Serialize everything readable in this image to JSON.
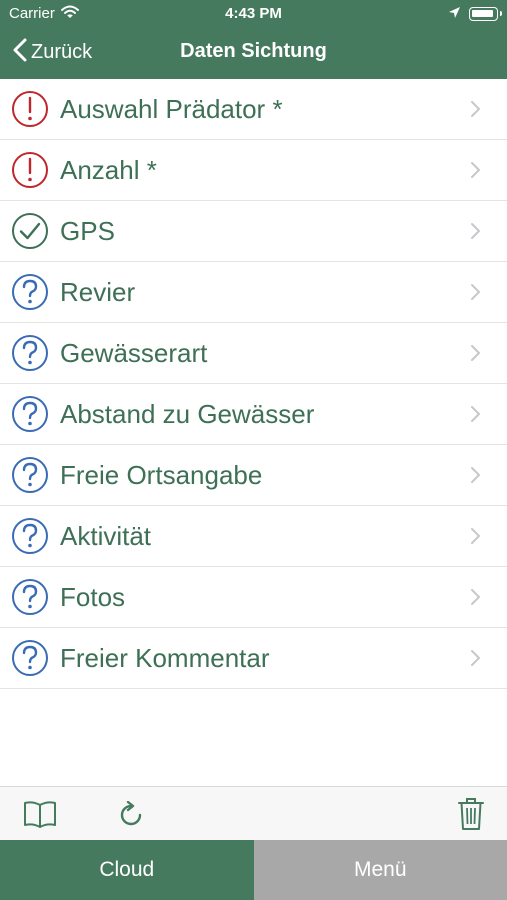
{
  "status_bar": {
    "carrier": "Carrier",
    "time": "4:43 PM"
  },
  "nav": {
    "back_label": "Zurück",
    "title": "Daten Sichtung"
  },
  "items": [
    {
      "label": "Auswahl Prädator *",
      "status": "required-missing"
    },
    {
      "label": "Anzahl *",
      "status": "required-missing"
    },
    {
      "label": "GPS",
      "status": "complete"
    },
    {
      "label": "Revier",
      "status": "optional"
    },
    {
      "label": "Gewässerart",
      "status": "optional"
    },
    {
      "label": "Abstand zu Gewässer",
      "status": "optional"
    },
    {
      "label": "Freie Ortsangabe",
      "status": "optional"
    },
    {
      "label": "Aktivität",
      "status": "optional"
    },
    {
      "label": "Fotos",
      "status": "optional"
    },
    {
      "label": "Freier Kommentar",
      "status": "optional"
    }
  ],
  "toolbar": {
    "left_icons": [
      "book-icon",
      "refresh-icon"
    ],
    "right_icons": [
      "trash-icon"
    ]
  },
  "tabs": {
    "cloud": "Cloud",
    "menu": "Menü"
  },
  "colors": {
    "header_bg": "#467a5f",
    "label_text": "#3e7056",
    "required_icon": "#c0272d",
    "complete_icon": "#3e7056",
    "optional_icon": "#3a6bb5",
    "menu_tab_bg": "#a8a8a8"
  }
}
